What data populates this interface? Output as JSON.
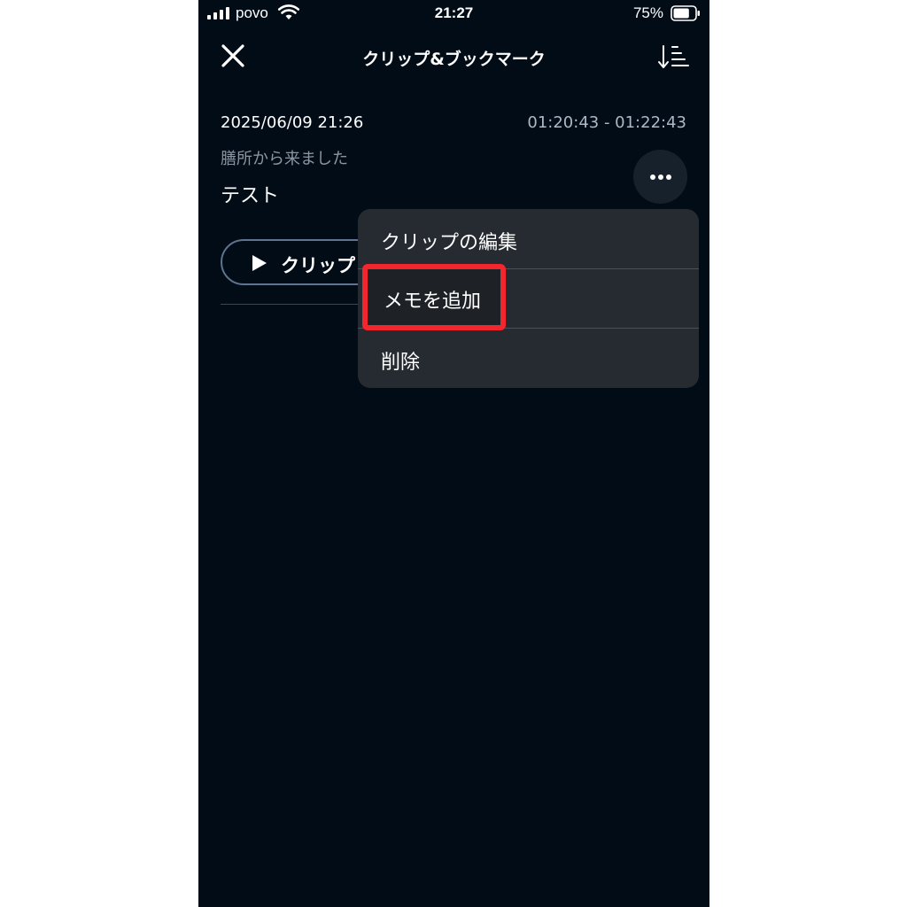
{
  "status_bar": {
    "carrier": "povo",
    "time": "21:27",
    "battery_percent": "75%",
    "battery_level": 0.75
  },
  "header": {
    "title": "クリップ&ブックマーク",
    "close_icon": "close-icon",
    "sort_icon": "sort-icon"
  },
  "clip": {
    "date": "2025/06/09 21:26",
    "range": "01:20:43 - 01:22:43",
    "subtitle": "膳所から来ました",
    "memo": "テスト",
    "play_label": "クリップ",
    "more_icon": "more-icon"
  },
  "context_menu": {
    "items": [
      {
        "label": "クリップの編集"
      },
      {
        "label": "メモを追加"
      },
      {
        "label": "削除"
      }
    ],
    "highlight_color": "#f2262c"
  }
}
